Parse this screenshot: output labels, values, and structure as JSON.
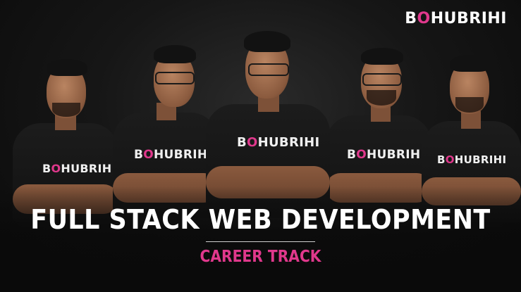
{
  "brand": {
    "prefix": "B",
    "accent_char": "O",
    "suffix": "HUBRIHI"
  },
  "shirts": [
    {
      "prefix": "B",
      "accent_char": "O",
      "suffix": "HUBRIH"
    },
    {
      "prefix": "B",
      "accent_char": "O",
      "suffix": "HUBRIHI"
    },
    {
      "prefix": "B",
      "accent_char": "O",
      "suffix": "HUBRIHI"
    },
    {
      "prefix": "B",
      "accent_char": "O",
      "suffix": "HUBRIHI"
    },
    {
      "prefix": "B",
      "accent_char": "O",
      "suffix": "HUBRIHI"
    }
  ],
  "headline": "FULL STACK WEB DEVELOPMENT",
  "subheadline": "CAREER TRACK",
  "colors": {
    "accent": "#e0388c",
    "background": "#111111",
    "text": "#ffffff"
  }
}
